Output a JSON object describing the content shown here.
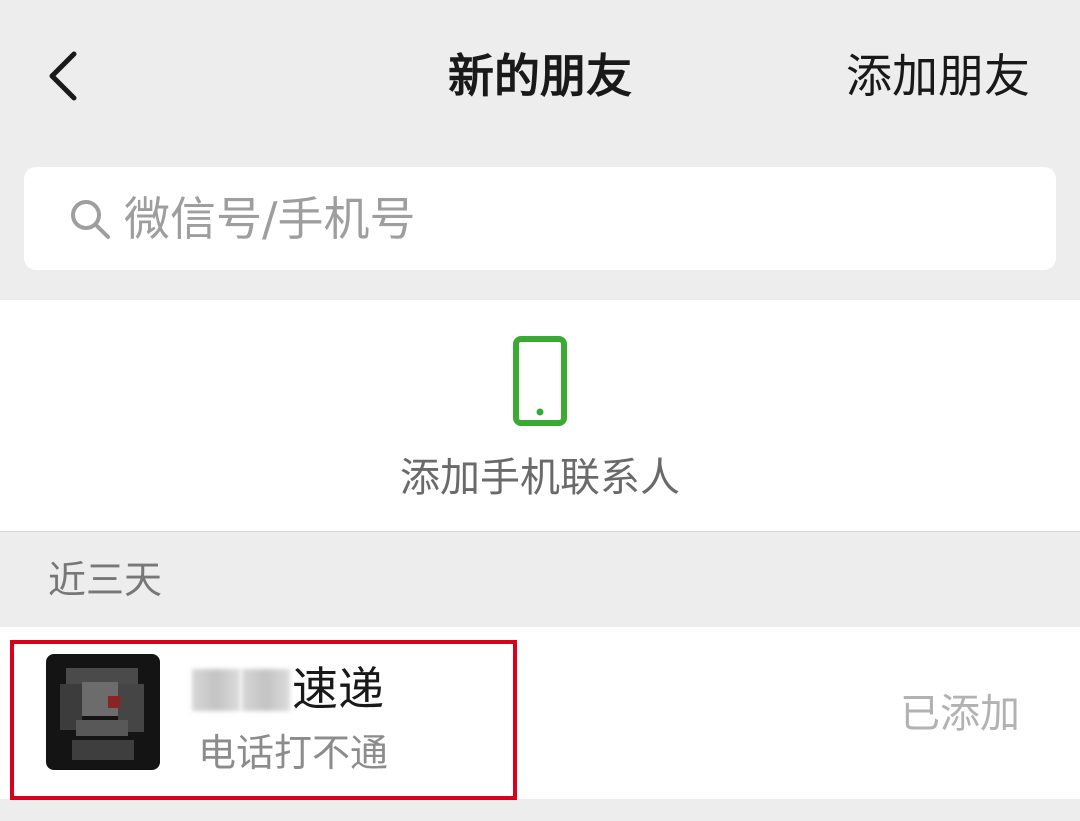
{
  "nav": {
    "back_icon": "chevron-left-icon",
    "title": "新的朋友",
    "action_label": "添加朋友"
  },
  "search": {
    "icon": "search-icon",
    "placeholder": "微信号/手机号",
    "value": ""
  },
  "phone_contacts": {
    "icon": "phone-icon",
    "icon_color": "#3aaa35",
    "label": "添加手机联系人"
  },
  "recent": {
    "header": "近三天",
    "items": [
      {
        "name_visible": "速递",
        "message": "电话打不通",
        "status": "已添加"
      }
    ]
  },
  "colors": {
    "background": "#ededed",
    "highlight": "#d9001b"
  }
}
